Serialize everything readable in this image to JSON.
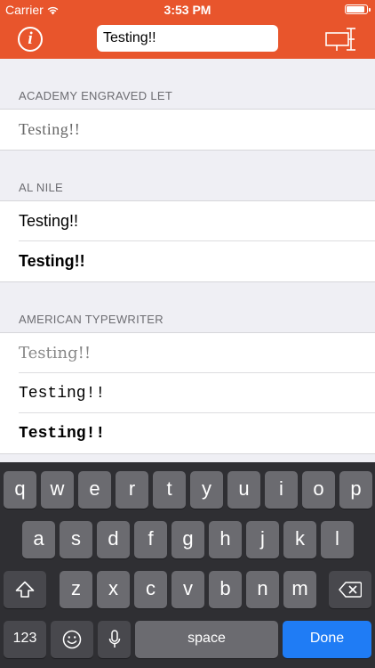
{
  "status_bar": {
    "carrier": "Carrier",
    "time": "3:53 PM"
  },
  "nav": {
    "info_label": "i",
    "search_value": "Testing!!"
  },
  "sections": [
    {
      "header": "ACADEMY ENGRAVED LET",
      "rows": [
        "Testing!!"
      ]
    },
    {
      "header": "AL NILE",
      "rows": [
        "Testing!!",
        "Testing!!"
      ]
    },
    {
      "header": "AMERICAN TYPEWRITER",
      "rows": [
        "Testing!!",
        "Testing!!",
        "Testing!!"
      ]
    }
  ],
  "keyboard": {
    "row1": [
      "q",
      "w",
      "e",
      "r",
      "t",
      "y",
      "u",
      "i",
      "o",
      "p"
    ],
    "row2": [
      "a",
      "s",
      "d",
      "f",
      "g",
      "h",
      "j",
      "k",
      "l"
    ],
    "row3": [
      "z",
      "x",
      "c",
      "v",
      "b",
      "n",
      "m"
    ],
    "numbers_label": "123",
    "space_label": "space",
    "done_label": "Done",
    "icons": {
      "shift": "shift-icon",
      "backspace": "backspace-icon",
      "emoji": "emoji-icon",
      "mic": "microphone-icon"
    }
  },
  "colors": {
    "accent": "#e8552c",
    "done": "#1f7cf5",
    "keyboard": "#2f2f33"
  }
}
